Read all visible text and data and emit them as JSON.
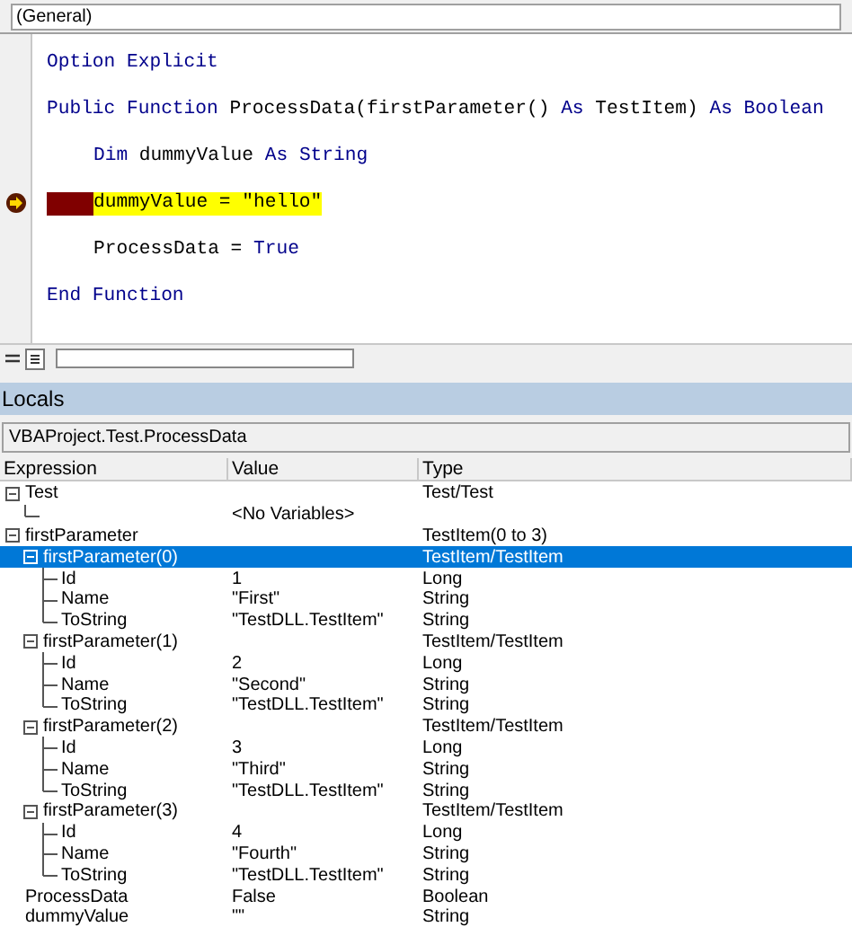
{
  "object_box": {
    "value": "(General)"
  },
  "code_lines": [
    {
      "indent": false,
      "current": false,
      "breakpoint": false,
      "tokens": [
        {
          "text": "Option Explicit",
          "kind": "keyword"
        }
      ]
    },
    {
      "indent": false,
      "current": false,
      "breakpoint": false,
      "tokens": [
        {
          "text": "Public Function",
          "kind": "keyword"
        },
        {
          "text": " ProcessData(firstParameter() ",
          "kind": "plain"
        },
        {
          "text": "As",
          "kind": "keyword"
        },
        {
          "text": " TestItem) ",
          "kind": "plain"
        },
        {
          "text": "As Boolean",
          "kind": "keyword"
        }
      ]
    },
    {
      "indent": true,
      "current": false,
      "breakpoint": false,
      "tokens": [
        {
          "text": "Dim",
          "kind": "keyword"
        },
        {
          "text": " dummyValue ",
          "kind": "plain"
        },
        {
          "text": "As String",
          "kind": "keyword"
        }
      ]
    },
    {
      "indent": true,
      "current": true,
      "breakpoint": true,
      "tokens": [
        {
          "text": "dummyValue = \"hello\"",
          "kind": "plain"
        }
      ]
    },
    {
      "indent": true,
      "current": false,
      "breakpoint": false,
      "tokens": [
        {
          "text": "ProcessData = ",
          "kind": "plain"
        },
        {
          "text": "True",
          "kind": "keyword"
        }
      ]
    },
    {
      "indent": false,
      "current": false,
      "breakpoint": false,
      "tokens": [
        {
          "text": "End Function",
          "kind": "keyword"
        }
      ]
    }
  ],
  "locals": {
    "title": "Locals",
    "context": "VBAProject.Test.ProcessData",
    "columns": [
      "Expression",
      "Value",
      "Type"
    ],
    "rows": [
      {
        "expression": "Test",
        "type": "Test/Test",
        "expanded": true,
        "selected": false,
        "children": [
          {
            "value": "<No Variables>",
            "selected": false
          }
        ]
      },
      {
        "expression": "firstParameter",
        "type": "TestItem(0 to 3)",
        "expanded": true,
        "selected": false,
        "children": [
          {
            "expression": "firstParameter(0)",
            "type": "TestItem/TestItem",
            "expanded": true,
            "selected": true,
            "children": [
              {
                "expression": "Id",
                "value": "1",
                "type": "Long",
                "selected": false
              },
              {
                "expression": "Name",
                "value": "\"First\"",
                "type": "String",
                "selected": false
              },
              {
                "expression": "ToString",
                "value": "\"TestDLL.TestItem\"",
                "type": "String",
                "selected": false
              }
            ]
          },
          {
            "expression": "firstParameter(1)",
            "type": "TestItem/TestItem",
            "expanded": true,
            "selected": false,
            "children": [
              {
                "expression": "Id",
                "value": "2",
                "type": "Long",
                "selected": false
              },
              {
                "expression": "Name",
                "value": "\"Second\"",
                "type": "String",
                "selected": false
              },
              {
                "expression": "ToString",
                "value": "\"TestDLL.TestItem\"",
                "type": "String",
                "selected": false
              }
            ]
          },
          {
            "expression": "firstParameter(2)",
            "type": "TestItem/TestItem",
            "expanded": true,
            "selected": false,
            "children": [
              {
                "expression": "Id",
                "value": "3",
                "type": "Long",
                "selected": false
              },
              {
                "expression": "Name",
                "value": "\"Third\"",
                "type": "String",
                "selected": false
              },
              {
                "expression": "ToString",
                "value": "\"TestDLL.TestItem\"",
                "type": "String",
                "selected": false
              }
            ]
          },
          {
            "expression": "firstParameter(3)",
            "type": "TestItem/TestItem",
            "expanded": true,
            "selected": false,
            "children": [
              {
                "expression": "Id",
                "value": "4",
                "type": "Long",
                "selected": false
              },
              {
                "expression": "Name",
                "value": "\"Fourth\"",
                "type": "String",
                "selected": false
              },
              {
                "expression": "ToString",
                "value": "\"TestDLL.TestItem\"",
                "type": "String",
                "selected": false
              }
            ]
          }
        ]
      },
      {
        "expression": "ProcessData",
        "value": "False",
        "type": "Boolean",
        "selected": false
      },
      {
        "expression": "dummyValue",
        "value": "\"\"",
        "type": "String",
        "selected": false
      }
    ]
  }
}
